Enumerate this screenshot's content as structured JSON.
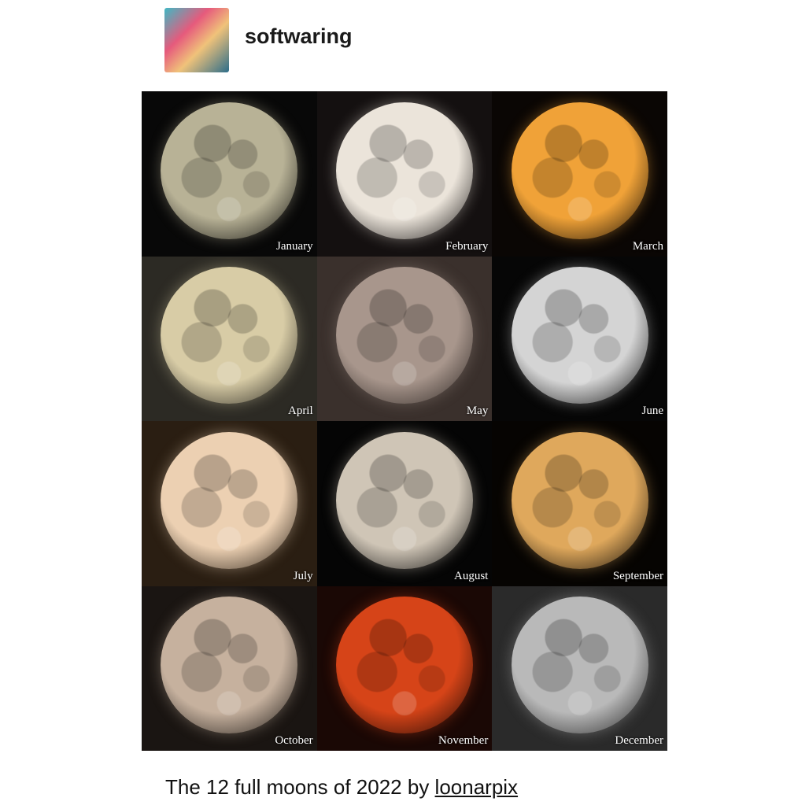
{
  "post": {
    "username": "softwaring",
    "caption_text": "The 12 full moons of 2022 by ",
    "caption_link": "loonarpix"
  },
  "moons": [
    {
      "label": "January",
      "color": "#b8b296",
      "bg": "#080808"
    },
    {
      "label": "February",
      "color": "#ebe4da",
      "bg": "#141010"
    },
    {
      "label": "March",
      "color": "#f0a238",
      "bg": "#0a0604"
    },
    {
      "label": "April",
      "color": "#d8cca6",
      "bg": "#2c2a24"
    },
    {
      "label": "May",
      "color": "#a8968c",
      "bg": "#3a302c"
    },
    {
      "label": "June",
      "color": "#d4d4d4",
      "bg": "#060606"
    },
    {
      "label": "July",
      "color": "#ecd0b2",
      "bg": "#2a1e12"
    },
    {
      "label": "August",
      "color": "#cfc5b6",
      "bg": "#050505"
    },
    {
      "label": "September",
      "color": "#dfa85c",
      "bg": "#060402"
    },
    {
      "label": "October",
      "color": "#c6b19e",
      "bg": "#1a1512"
    },
    {
      "label": "November",
      "color": "#d64418",
      "bg": "#1a0805"
    },
    {
      "label": "December",
      "color": "#b9b9b9",
      "bg": "#2a2a2a"
    }
  ]
}
